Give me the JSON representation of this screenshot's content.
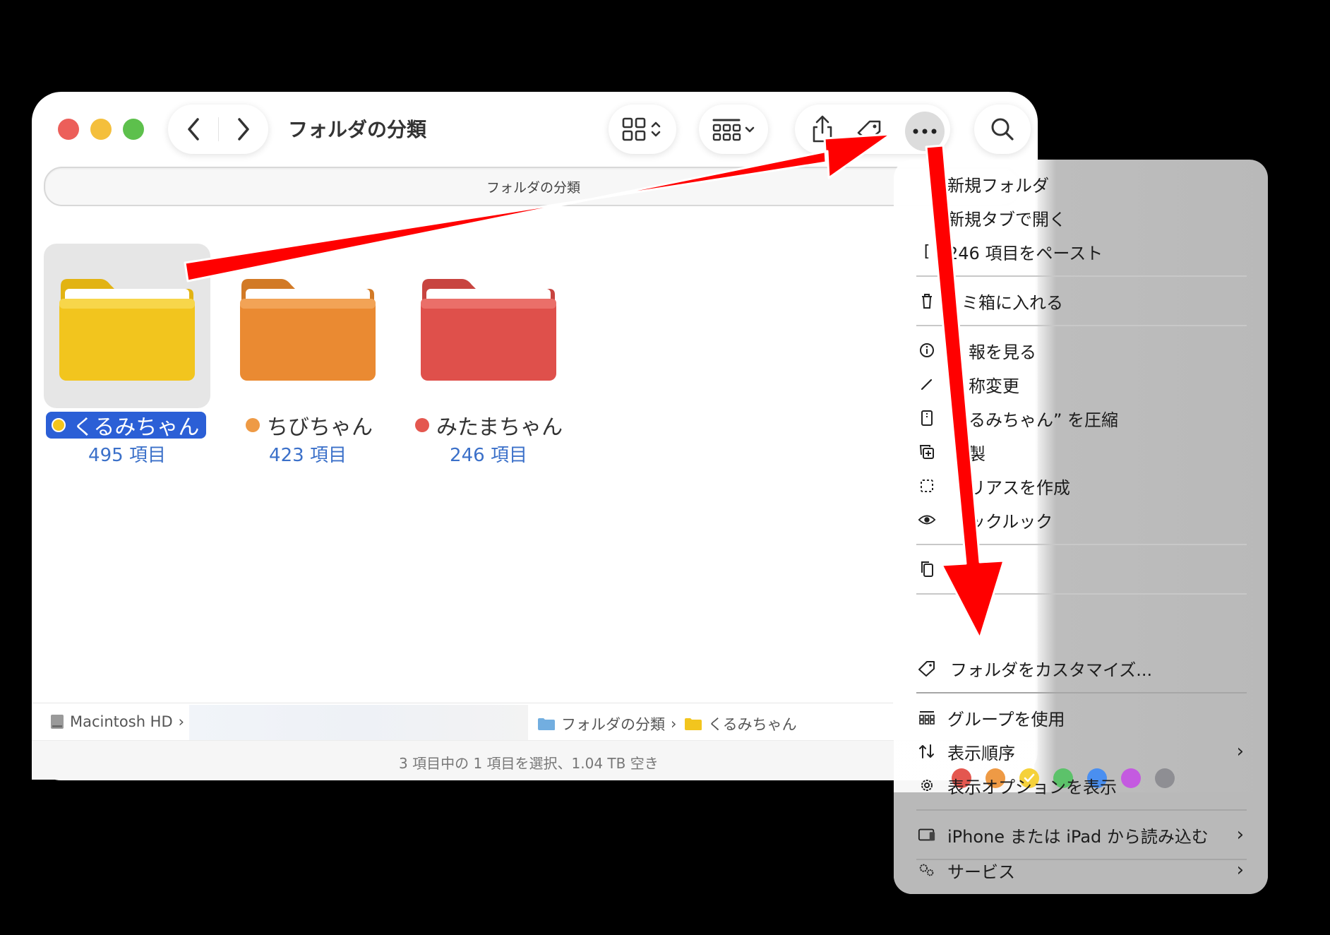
{
  "window": {
    "title": "フォルダの分類",
    "path_top": "フォルダの分類"
  },
  "folders": [
    {
      "name": "くるみちゃん",
      "count": "495 項目",
      "tag_color": "#f4c51c",
      "folder_color": "#f3c61d",
      "selected": true
    },
    {
      "name": "ちびちゃん",
      "count": "423 項目",
      "tag_color": "#ee9a45",
      "folder_color": "#ec8d34",
      "selected": false
    },
    {
      "name": "みたまちゃん",
      "count": "246 項目",
      "tag_color": "#e4574f",
      "folder_color": "#e0524c",
      "selected": false
    }
  ],
  "pathbar": {
    "disk": "Macintosh HD",
    "sep": "›",
    "folder1": "フォルダの分類",
    "folder2": "くるみちゃん"
  },
  "status": "3 項目中の 1 項目を選択、1.04 TB 空き",
  "menu": {
    "new_folder": "新規フォルダ",
    "open_new_tab": "新規タブで開く",
    "paste": "246 項目をペースト",
    "trash": "ミ箱に入れる",
    "get_info": "報を見る",
    "rename": "称変更",
    "compress": "るみちゃん” を圧縮",
    "duplicate": "製",
    "make_alias": "リアスを作成",
    "quick_look": "ックルック",
    "copy": "",
    "customize": "フォルダをカスタマイズ...",
    "use_groups": "グループを使用",
    "sort_by": "表示順序",
    "show_view_options": "表示オプションを表示",
    "import_iphone": "iPhone または iPad から読み込む",
    "services": "サービス",
    "chevron": "›"
  },
  "tag_colors": [
    "#e4574f",
    "#ee9a45",
    "#f5d13a",
    "#5cc26a",
    "#4a8ff0",
    "#c45ae0",
    "#8e8e93"
  ],
  "arrow_color": "#ff0000"
}
